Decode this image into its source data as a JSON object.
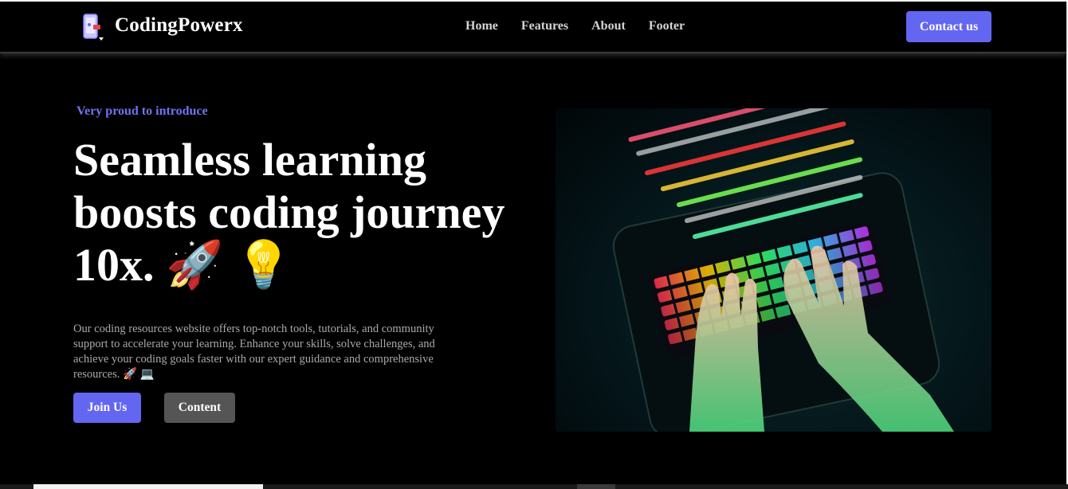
{
  "nav": {
    "brand": "CodingPowerx",
    "links": [
      "Home",
      "Features",
      "About",
      "Footer"
    ],
    "contact_label": "Contact us"
  },
  "hero": {
    "eyebrow": "Very proud to introduce",
    "headline_line1": "Seamless learning",
    "headline_line2": "boosts coding journey",
    "headline_line3": "10x.",
    "headline_emojis": "🚀 💡",
    "description": "Our coding resources website offers top-notch tools, tutorials, and community support to accelerate your learning. Enhance your skills, solve challenges, and achieve your coding goals faster with our expert guidance and comprehensive resources. 🚀 💻",
    "join_label": "Join Us",
    "content_label": "Content",
    "image_alt": "hands typing on RGB keyboard with code overlay"
  },
  "colors": {
    "accent": "#6366f1",
    "eyebrow": "#6f73f2",
    "secondary_button": "#555555",
    "background": "#000000"
  },
  "icons": {
    "logo": "phone-logo-icon"
  }
}
